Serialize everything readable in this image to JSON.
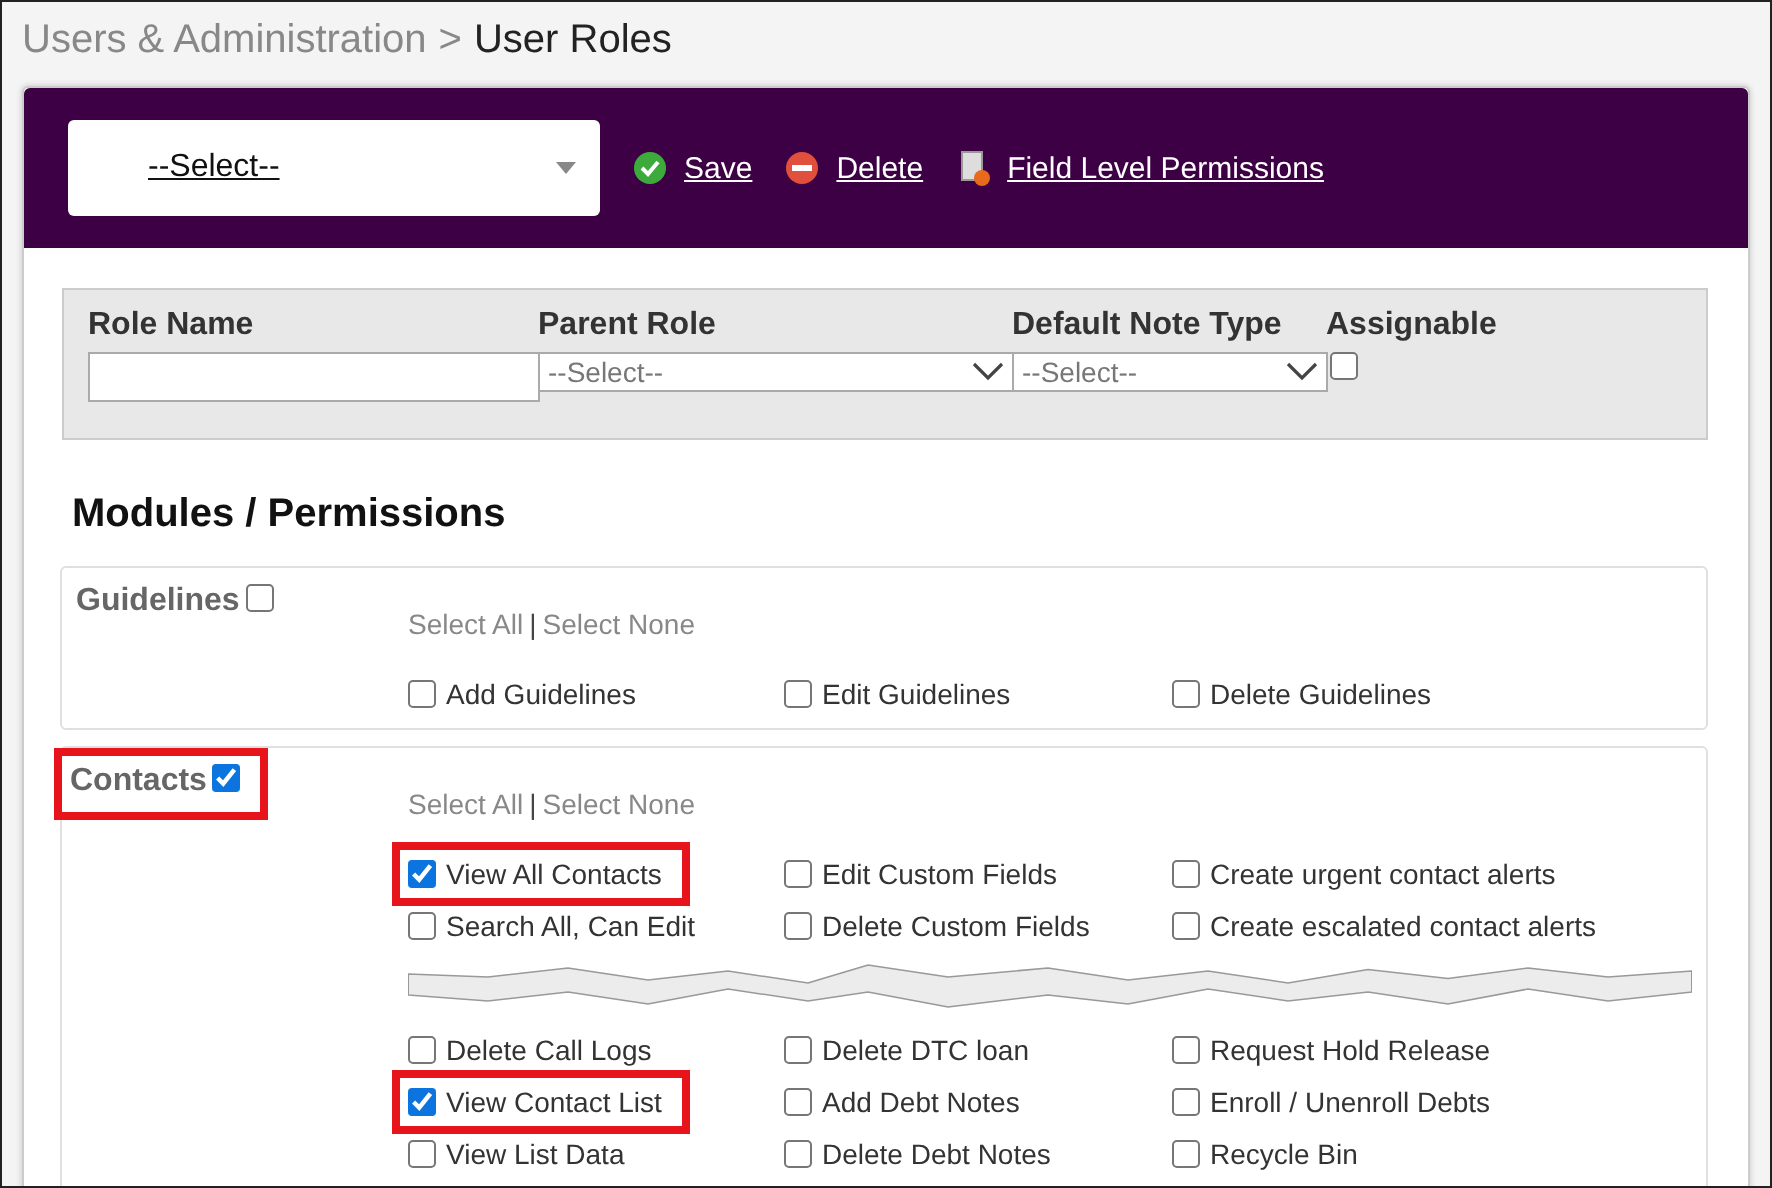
{
  "breadcrumb": {
    "parent": "Users & Administration",
    "separator": ">",
    "current": "User Roles"
  },
  "toolbar": {
    "select": "--Select--",
    "actions": [
      {
        "kind": "save",
        "label": "Save"
      },
      {
        "kind": "delete",
        "label": "Delete"
      },
      {
        "kind": "fields",
        "label": "Field Level Permissions"
      }
    ]
  },
  "role_form": {
    "fields": [
      {
        "kind": "text",
        "label": "Role Name"
      },
      {
        "kind": "select",
        "label": "Parent Role",
        "value": "--Select--"
      },
      {
        "kind": "select",
        "label": "Default Note Type",
        "value": "--Select--"
      },
      {
        "kind": "checkbox",
        "label": "Assignable",
        "checked": false
      }
    ]
  },
  "modules_heading": "Modules / Permissions",
  "modules": [
    {
      "name": "Guidelines",
      "checked": false,
      "highlighted": false,
      "select_all": "Select All",
      "divider": "|",
      "select_none": "Select None",
      "sections": [
        [
          [
            {
              "label": "Add Guidelines",
              "checked": false,
              "highlighted": false
            },
            {
              "label": "Edit Guidelines",
              "checked": false,
              "highlighted": false
            },
            {
              "label": "Delete Guidelines",
              "checked": false,
              "highlighted": false
            }
          ]
        ]
      ]
    },
    {
      "name": "Contacts",
      "checked": true,
      "highlighted": true,
      "select_all": "Select All",
      "divider": "|",
      "select_none": "Select None",
      "sections": [
        [
          [
            {
              "label": "View All Contacts",
              "checked": true,
              "highlighted": true
            },
            {
              "label": "Edit Custom Fields",
              "checked": false,
              "highlighted": false
            },
            {
              "label": "Create urgent contact alerts",
              "checked": false,
              "highlighted": false
            }
          ],
          [
            {
              "label": "Search All, Can Edit",
              "checked": false,
              "highlighted": false
            },
            {
              "label": "Delete Custom Fields",
              "checked": false,
              "highlighted": false
            },
            {
              "label": "Create escalated contact alerts",
              "checked": false,
              "highlighted": false
            }
          ]
        ],
        [
          [
            {
              "label": "Delete Call Logs",
              "checked": false,
              "highlighted": false
            },
            {
              "label": "Delete DTC loan",
              "checked": false,
              "highlighted": false
            },
            {
              "label": "Request Hold Release",
              "checked": false,
              "highlighted": false
            }
          ],
          [
            {
              "label": "View Contact List",
              "checked": true,
              "highlighted": true
            },
            {
              "label": "Add Debt Notes",
              "checked": false,
              "highlighted": false
            },
            {
              "label": "Enroll / Unenroll Debts",
              "checked": false,
              "highlighted": false
            }
          ],
          [
            {
              "label": "View List Data",
              "checked": false,
              "highlighted": false
            },
            {
              "label": "Delete Debt Notes",
              "checked": false,
              "highlighted": false
            },
            {
              "label": "Recycle Bin",
              "checked": false,
              "highlighted": false
            }
          ]
        ]
      ]
    }
  ]
}
